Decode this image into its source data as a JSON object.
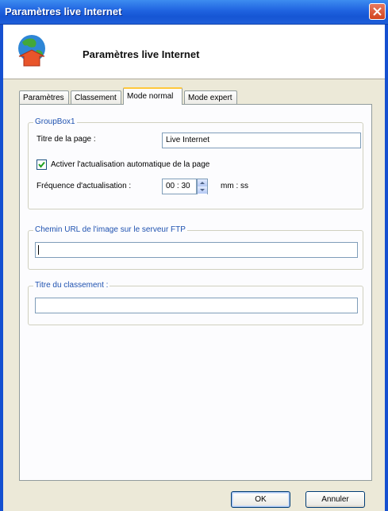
{
  "window": {
    "title": "Paramètres live Internet"
  },
  "header": {
    "title": "Paramètres live Internet",
    "icon": "globe-arrow-icon"
  },
  "tabs": [
    {
      "label": "Paramètres",
      "active": false
    },
    {
      "label": "Classement",
      "active": false
    },
    {
      "label": "Mode normal",
      "active": true
    },
    {
      "label": "Mode expert",
      "active": false
    }
  ],
  "group1": {
    "legend": "GroupBox1",
    "page_title_label": "Titre de la page :",
    "page_title_value": "Live Internet",
    "auto_refresh_label": "Activer l'actualisation automatique de la page",
    "auto_refresh_checked": true,
    "refresh_freq_label": "Fréquence d'actualisation :",
    "refresh_freq_value": "00 : 30",
    "refresh_unit": "mm : ss"
  },
  "group2": {
    "legend": "Chemin URL de l'image sur le serveur FTP",
    "value": ""
  },
  "group3": {
    "legend": "Titre du classement :",
    "value": ""
  },
  "buttons": {
    "ok": "OK",
    "cancel": "Annuler"
  },
  "colors": {
    "titlebar": "#1f63e0",
    "dialog_bg": "#ece9d8",
    "legend": "#1f52b0",
    "active_tab_accent": "#ffc83c"
  }
}
